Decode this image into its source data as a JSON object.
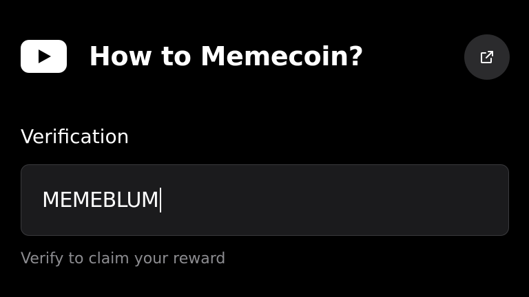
{
  "header": {
    "icon": "youtube-icon",
    "title": "How to Memecoin?",
    "open_icon": "external-link-icon"
  },
  "verification": {
    "label": "Verification",
    "value": "MEMEBLUM",
    "hint": "Verify to claim your reward"
  },
  "colors": {
    "background": "#000000",
    "field_background": "#1b1b1d",
    "field_border": "#3a3a3d",
    "button_background": "#2b2b2d",
    "hint_text": "#8c8c90"
  }
}
